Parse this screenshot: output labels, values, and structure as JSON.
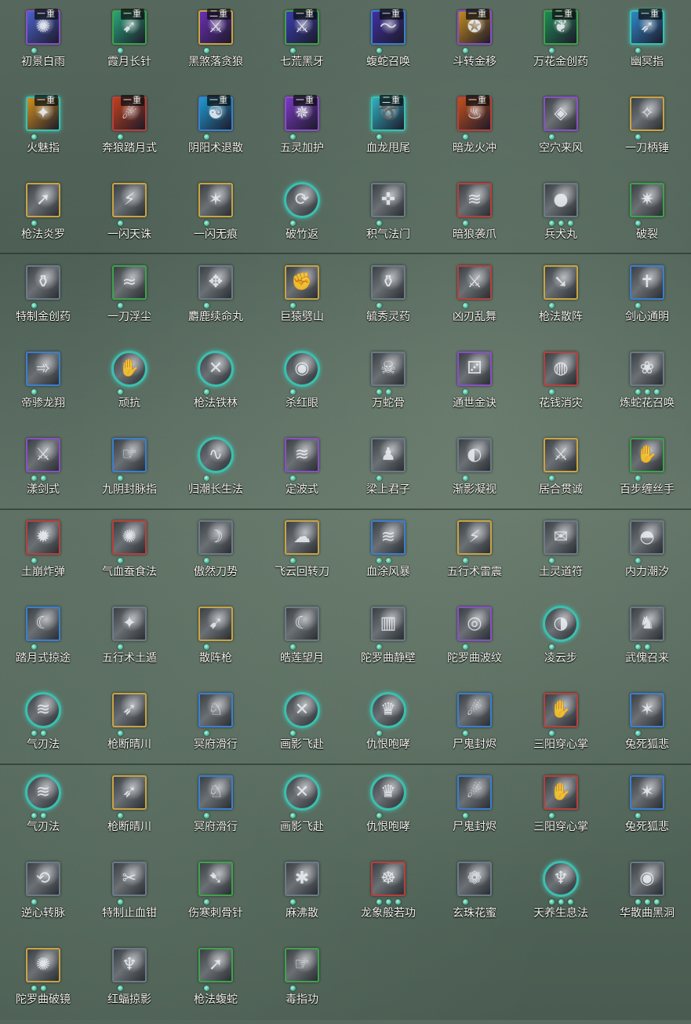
{
  "colors": {
    "border_purple": "#8a4fc7",
    "border_gold": "#c9a443",
    "border_red": "#b8403c",
    "border_blue": "#3a7fd0",
    "border_green": "#3fa24c",
    "border_teal": "#3cbfae",
    "border_gray": "#6c7b86",
    "dot_teal": "#3fb99a"
  },
  "skills": [
    {
      "name": "初景白雨",
      "rank": "一重",
      "border": "purple",
      "shape": "square",
      "dots": 1,
      "icon": "water-swirl-icon",
      "tint": "#4a62c9"
    },
    {
      "name": "霞月长针",
      "rank": "一重",
      "border": "green",
      "shape": "square",
      "dots": 1,
      "icon": "needle-icon",
      "tint": "#2aa57a"
    },
    {
      "name": "黑煞落贪狼",
      "rank": "二重",
      "border": "gold",
      "shape": "square",
      "dots": 1,
      "icon": "dark-blade-icon",
      "tint": "#6a2fb5"
    },
    {
      "name": "七荒黑牙",
      "rank": "一重",
      "border": "green",
      "shape": "square",
      "dots": 1,
      "icon": "fang-icon",
      "tint": "#3a3fb0"
    },
    {
      "name": "蝮蛇召唤",
      "rank": "一重",
      "border": "blue",
      "shape": "square",
      "dots": 1,
      "icon": "snake-icon",
      "tint": "#4030a0"
    },
    {
      "name": "斗转金移",
      "rank": "一重",
      "border": "purple",
      "shape": "square",
      "dots": 1,
      "icon": "gold-swirl-icon",
      "tint": "#c08a20"
    },
    {
      "name": "万花金创药",
      "rank": "二重",
      "border": "green",
      "shape": "square",
      "dots": 1,
      "icon": "herb-icon",
      "tint": "#1f8a55"
    },
    {
      "name": "幽冥指",
      "rank": "一重",
      "border": "teal",
      "shape": "square",
      "dots": 1,
      "icon": "finger-strike-icon",
      "tint": "#2f88c9"
    },
    {
      "name": "火魅指",
      "rank": "一重",
      "border": "teal",
      "shape": "square",
      "dots": 1,
      "icon": "fire-finger-icon",
      "tint": "#d0901f"
    },
    {
      "name": "奔狼踏月式",
      "rank": "一重",
      "border": "red",
      "shape": "square",
      "dots": 1,
      "icon": "wolf-icon",
      "tint": "#c0401c"
    },
    {
      "name": "阴阳术退散",
      "rank": "一重",
      "border": "blue",
      "shape": "square",
      "dots": 1,
      "icon": "yin-yang-icon",
      "tint": "#1f9ad0"
    },
    {
      "name": "五灵加护",
      "rank": "一重",
      "border": "purple",
      "shape": "square",
      "dots": 1,
      "icon": "five-spirit-icon",
      "tint": "#7a3ac0"
    },
    {
      "name": "血龙甩尾",
      "rank": "二重",
      "border": "teal",
      "shape": "square",
      "dots": 1,
      "icon": "dragon-tail-icon",
      "tint": "#2fb0c0"
    },
    {
      "name": "暗龙火冲",
      "rank": "一重",
      "border": "red",
      "shape": "square",
      "dots": 1,
      "icon": "flame-dash-icon",
      "tint": "#c0501c"
    },
    {
      "name": "空穴来风",
      "rank": "",
      "border": "purple",
      "shape": "square",
      "dots": 1,
      "icon": "coin-wind-icon",
      "tint": ""
    },
    {
      "name": "一刀柄锤",
      "rank": "",
      "border": "gold",
      "shape": "square",
      "dots": 1,
      "icon": "hilt-strike-icon",
      "tint": ""
    },
    {
      "name": "枪法炎罗",
      "rank": "",
      "border": "gold",
      "shape": "square",
      "dots": 1,
      "icon": "spear-icon",
      "tint": ""
    },
    {
      "name": "一闪天诛",
      "rank": "",
      "border": "gold",
      "shape": "square",
      "dots": 1,
      "icon": "flash-slash-icon",
      "tint": ""
    },
    {
      "name": "一闪无痕",
      "rank": "",
      "border": "gold",
      "shape": "square",
      "dots": 1,
      "icon": "shadow-slash-icon",
      "tint": ""
    },
    {
      "name": "破竹返",
      "rank": "",
      "border": "teal",
      "shape": "round",
      "dots": 1,
      "icon": "bamboo-counter-icon",
      "tint": ""
    },
    {
      "name": "积气法门",
      "rank": "",
      "border": "gray",
      "shape": "square",
      "dots": 1,
      "icon": "qi-gate-icon",
      "tint": ""
    },
    {
      "name": "暗狼袭爪",
      "rank": "",
      "border": "red",
      "shape": "square",
      "dots": 1,
      "icon": "claw-icon",
      "tint": ""
    },
    {
      "name": "兵犬丸",
      "rank": "",
      "border": "gray",
      "shape": "square",
      "dots": 3,
      "icon": "pill-icon",
      "tint": ""
    },
    {
      "name": "破裂",
      "rank": "",
      "border": "green",
      "shape": "square",
      "dots": 1,
      "icon": "shatter-icon",
      "tint": ""
    },
    {
      "name": "特制金创药",
      "rank": "",
      "border": "gray",
      "shape": "square",
      "dots": 1,
      "icon": "potion-icon",
      "tint": ""
    },
    {
      "name": "一刀浮尘",
      "rank": "",
      "border": "green",
      "shape": "square",
      "dots": 1,
      "icon": "dust-slash-icon",
      "tint": ""
    },
    {
      "name": "麝鹿续命丸",
      "rank": "",
      "border": "gray",
      "shape": "square",
      "dots": 1,
      "icon": "elixir-icon",
      "tint": ""
    },
    {
      "name": "巨猿劈山",
      "rank": "",
      "border": "gold",
      "shape": "square",
      "dots": 1,
      "icon": "ape-icon",
      "tint": ""
    },
    {
      "name": "毓秀灵药",
      "rank": "",
      "border": "gray",
      "shape": "square",
      "dots": 1,
      "icon": "gourd-icon",
      "tint": ""
    },
    {
      "name": "凶刃乱舞",
      "rank": "",
      "border": "red",
      "shape": "square",
      "dots": 1,
      "icon": "blade-dance-icon",
      "tint": ""
    },
    {
      "name": "枪法散阵",
      "rank": "",
      "border": "gold",
      "shape": "square",
      "dots": 1,
      "icon": "spear-sweep-icon",
      "tint": ""
    },
    {
      "name": "剑心通明",
      "rank": "",
      "border": "blue",
      "shape": "square",
      "dots": 1,
      "icon": "sword-heart-icon",
      "tint": ""
    },
    {
      "name": "帝骖龙翔",
      "rank": "",
      "border": "blue",
      "shape": "square",
      "dots": 1,
      "icon": "dragon-flight-icon",
      "tint": ""
    },
    {
      "name": "顽抗",
      "rank": "",
      "border": "teal",
      "shape": "round",
      "dots": 1,
      "icon": "resist-icon",
      "tint": ""
    },
    {
      "name": "枪法铁林",
      "rank": "",
      "border": "teal",
      "shape": "round",
      "dots": 1,
      "icon": "spear-forest-icon",
      "tint": ""
    },
    {
      "name": "杀红眼",
      "rank": "",
      "border": "teal",
      "shape": "round",
      "dots": 1,
      "icon": "rage-icon",
      "tint": ""
    },
    {
      "name": "万蛇骨",
      "rank": "",
      "border": "gray",
      "shape": "square",
      "dots": 2,
      "icon": "snake-bone-icon",
      "tint": ""
    },
    {
      "name": "通世金诀",
      "rank": "",
      "border": "purple",
      "shape": "square",
      "dots": 1,
      "icon": "dice-icon",
      "tint": ""
    },
    {
      "name": "花钱消灾",
      "rank": "",
      "border": "red",
      "shape": "square",
      "dots": 1,
      "icon": "money-bag-icon",
      "tint": ""
    },
    {
      "name": "炼蛇花召唤",
      "rank": "",
      "border": "gray",
      "shape": "square",
      "dots": 3,
      "icon": "serpent-flower-icon",
      "tint": ""
    },
    {
      "name": "漾剑式",
      "rank": "",
      "border": "purple",
      "shape": "square",
      "dots": 2,
      "icon": "ripple-sword-icon",
      "tint": ""
    },
    {
      "name": "九阴封脉指",
      "rank": "",
      "border": "blue",
      "shape": "square",
      "dots": 1,
      "icon": "seal-finger-icon",
      "tint": ""
    },
    {
      "name": "归潮长生法",
      "rank": "",
      "border": "teal",
      "shape": "round",
      "dots": 1,
      "icon": "tide-icon",
      "tint": ""
    },
    {
      "name": "定波式",
      "rank": "",
      "border": "purple",
      "shape": "square",
      "dots": 1,
      "icon": "wave-stance-icon",
      "tint": ""
    },
    {
      "name": "梁上君子",
      "rank": "",
      "border": "gray",
      "shape": "square",
      "dots": 1,
      "icon": "thief-icon",
      "tint": ""
    },
    {
      "name": "渐影凝视",
      "rank": "",
      "border": "gray",
      "shape": "square",
      "dots": 1,
      "icon": "gaze-icon",
      "tint": ""
    },
    {
      "name": "居合贯诚",
      "rank": "",
      "border": "gold",
      "shape": "square",
      "dots": 1,
      "icon": "iai-icon",
      "tint": ""
    },
    {
      "name": "百步缠丝手",
      "rank": "",
      "border": "green",
      "shape": "square",
      "dots": 1,
      "icon": "silk-hand-icon",
      "tint": ""
    },
    {
      "name": "土崩炸弹",
      "rank": "",
      "border": "red",
      "shape": "square",
      "dots": 1,
      "icon": "bomb-icon",
      "tint": ""
    },
    {
      "name": "气血蚕食法",
      "rank": "",
      "border": "red",
      "shape": "square",
      "dots": 1,
      "icon": "drain-icon",
      "tint": ""
    },
    {
      "name": "傲然刀势",
      "rank": "",
      "border": "gray",
      "shape": "square",
      "dots": 1,
      "icon": "proud-blade-icon",
      "tint": ""
    },
    {
      "name": "飞云回转刀",
      "rank": "",
      "border": "gold",
      "shape": "square",
      "dots": 1,
      "icon": "cloud-blade-icon",
      "tint": ""
    },
    {
      "name": "血涂风暴",
      "rank": "",
      "border": "blue",
      "shape": "square",
      "dots": 2,
      "icon": "blood-storm-icon",
      "tint": ""
    },
    {
      "name": "五行术雷震",
      "rank": "",
      "border": "gold",
      "shape": "square",
      "dots": 1,
      "icon": "thunder-icon",
      "tint": ""
    },
    {
      "name": "土灵道符",
      "rank": "",
      "border": "gray",
      "shape": "square",
      "dots": 1,
      "icon": "talisman-icon",
      "tint": ""
    },
    {
      "name": "内力潮汐",
      "rank": "",
      "border": "gray",
      "shape": "square",
      "dots": 1,
      "icon": "inner-tide-icon",
      "tint": ""
    },
    {
      "name": "踏月式掠途",
      "rank": "",
      "border": "blue",
      "shape": "square",
      "dots": 1,
      "icon": "moon-step-icon",
      "tint": ""
    },
    {
      "name": "五行术土遁",
      "rank": "",
      "border": "gray",
      "shape": "square",
      "dots": 1,
      "icon": "earth-escape-icon",
      "tint": ""
    },
    {
      "name": "散阵枪",
      "rank": "",
      "border": "gold",
      "shape": "square",
      "dots": 1,
      "icon": "scatter-spear-icon",
      "tint": ""
    },
    {
      "name": "皓莲望月",
      "rank": "",
      "border": "gray",
      "shape": "square",
      "dots": 1,
      "icon": "lotus-moon-icon",
      "tint": ""
    },
    {
      "name": "陀罗曲静壁",
      "rank": "",
      "border": "gray",
      "shape": "square",
      "dots": 1,
      "icon": "still-wall-icon",
      "tint": ""
    },
    {
      "name": "陀罗曲波纹",
      "rank": "",
      "border": "purple",
      "shape": "square",
      "dots": 1,
      "icon": "ripple-icon",
      "tint": ""
    },
    {
      "name": "凌云步",
      "rank": "",
      "border": "teal",
      "shape": "round",
      "dots": 1,
      "icon": "cloud-step-icon",
      "tint": ""
    },
    {
      "name": "武傀召来",
      "rank": "",
      "border": "gray",
      "shape": "square",
      "dots": 2,
      "icon": "puppet-icon",
      "tint": ""
    },
    {
      "name": "气刃法",
      "rank": "",
      "border": "teal",
      "shape": "round",
      "dots": 2,
      "icon": "qi-blade-icon",
      "tint": ""
    },
    {
      "name": "枪断晴川",
      "rank": "",
      "border": "gold",
      "shape": "square",
      "dots": 1,
      "icon": "spear-break-icon",
      "tint": ""
    },
    {
      "name": "冥府滑行",
      "rank": "",
      "border": "blue",
      "shape": "square",
      "dots": 1,
      "icon": "underworld-glide-icon",
      "tint": ""
    },
    {
      "name": "画影飞赴",
      "rank": "",
      "border": "teal",
      "shape": "round",
      "dots": 1,
      "icon": "shadow-rush-icon",
      "tint": ""
    },
    {
      "name": "仇恨咆哮",
      "rank": "",
      "border": "teal",
      "shape": "round",
      "dots": 1,
      "icon": "roar-icon",
      "tint": ""
    },
    {
      "name": "尸鬼封烬",
      "rank": "",
      "border": "blue",
      "shape": "square",
      "dots": 1,
      "icon": "ghoul-seal-icon",
      "tint": ""
    },
    {
      "name": "三阳穿心掌",
      "rank": "",
      "border": "red",
      "shape": "square",
      "dots": 1,
      "icon": "palm-icon",
      "tint": ""
    },
    {
      "name": "兔死狐悲",
      "rank": "",
      "border": "blue",
      "shape": "square",
      "dots": 1,
      "icon": "fox-icon",
      "tint": ""
    },
    {
      "name": "气刃法",
      "rank": "",
      "border": "teal",
      "shape": "round",
      "dots": 2,
      "icon": "qi-blade-icon",
      "tint": ""
    },
    {
      "name": "枪断晴川",
      "rank": "",
      "border": "gold",
      "shape": "square",
      "dots": 1,
      "icon": "spear-break-icon",
      "tint": ""
    },
    {
      "name": "冥府滑行",
      "rank": "",
      "border": "blue",
      "shape": "square",
      "dots": 1,
      "icon": "underworld-glide-icon",
      "tint": ""
    },
    {
      "name": "画影飞赴",
      "rank": "",
      "border": "teal",
      "shape": "round",
      "dots": 1,
      "icon": "shadow-rush-icon",
      "tint": ""
    },
    {
      "name": "仇恨咆哮",
      "rank": "",
      "border": "teal",
      "shape": "round",
      "dots": 1,
      "icon": "roar-icon",
      "tint": ""
    },
    {
      "name": "尸鬼封烬",
      "rank": "",
      "border": "blue",
      "shape": "square",
      "dots": 1,
      "icon": "ghoul-seal-icon",
      "tint": ""
    },
    {
      "name": "三阳穿心掌",
      "rank": "",
      "border": "red",
      "shape": "square",
      "dots": 1,
      "icon": "palm-icon",
      "tint": ""
    },
    {
      "name": "兔死狐悲",
      "rank": "",
      "border": "blue",
      "shape": "square",
      "dots": 1,
      "icon": "fox-icon",
      "tint": ""
    },
    {
      "name": "逆心转脉",
      "rank": "",
      "border": "gray",
      "shape": "square",
      "dots": 1,
      "icon": "reverse-pulse-icon",
      "tint": ""
    },
    {
      "name": "特制止血钳",
      "rank": "",
      "border": "gray",
      "shape": "square",
      "dots": 1,
      "icon": "clamp-icon",
      "tint": ""
    },
    {
      "name": "伤寒刺骨针",
      "rank": "",
      "border": "green",
      "shape": "square",
      "dots": 1,
      "icon": "bone-needle-icon",
      "tint": ""
    },
    {
      "name": "麻沸散",
      "rank": "",
      "border": "gray",
      "shape": "square",
      "dots": 1,
      "icon": "numbing-powder-icon",
      "tint": ""
    },
    {
      "name": "龙象般若功",
      "rank": "",
      "border": "red",
      "shape": "square",
      "dots": 3,
      "icon": "prajna-icon",
      "tint": ""
    },
    {
      "name": "玄珠花蜜",
      "rank": "",
      "border": "gray",
      "shape": "square",
      "dots": 1,
      "icon": "nectar-icon",
      "tint": ""
    },
    {
      "name": "天养生息法",
      "rank": "",
      "border": "teal",
      "shape": "round",
      "dots": 3,
      "icon": "rest-icon",
      "tint": ""
    },
    {
      "name": "华散曲黑洞",
      "rank": "",
      "border": "gray",
      "shape": "square",
      "dots": 3,
      "icon": "black-hole-icon",
      "tint": ""
    },
    {
      "name": "陀罗曲破镜",
      "rank": "",
      "border": "gold",
      "shape": "square",
      "dots": 2,
      "icon": "mirror-break-icon",
      "tint": ""
    },
    {
      "name": "红蝠掠影",
      "rank": "",
      "border": "gray",
      "shape": "square",
      "dots": 1,
      "icon": "bat-icon",
      "tint": ""
    },
    {
      "name": "枪法蝮蛇",
      "rank": "",
      "border": "green",
      "shape": "square",
      "dots": 1,
      "icon": "viper-spear-icon",
      "tint": ""
    },
    {
      "name": "毒指功",
      "rank": "",
      "border": "green",
      "shape": "square",
      "dots": 1,
      "icon": "poison-finger-icon",
      "tint": ""
    }
  ],
  "glyphs": {
    "water-swirl-icon": "✺",
    "needle-icon": "➹",
    "dark-blade-icon": "⚔",
    "fang-icon": "⚔",
    "snake-icon": "〜",
    "gold-swirl-icon": "✪",
    "herb-icon": "❦",
    "finger-strike-icon": "➶",
    "fire-finger-icon": "✦",
    "wolf-icon": "☄",
    "yin-yang-icon": "☯",
    "five-spirit-icon": "✵",
    "dragon-tail-icon": "➰",
    "flame-dash-icon": "♨",
    "coin-wind-icon": "◈",
    "hilt-strike-icon": "✧",
    "spear-icon": "➚",
    "flash-slash-icon": "⚡",
    "shadow-slash-icon": "✶",
    "bamboo-counter-icon": "⟳",
    "qi-gate-icon": "✜",
    "claw-icon": "≋",
    "pill-icon": "●",
    "shatter-icon": "✷",
    "potion-icon": "⚱",
    "dust-slash-icon": "≈",
    "elixir-icon": "✥",
    "ape-icon": "✊",
    "gourd-icon": "⚱",
    "blade-dance-icon": "⚔",
    "spear-sweep-icon": "➘",
    "sword-heart-icon": "✝",
    "dragon-flight-icon": "➾",
    "resist-icon": "✋",
    "spear-forest-icon": "✕",
    "rage-icon": "◉",
    "snake-bone-icon": "☠",
    "dice-icon": "⚂",
    "money-bag-icon": "◍",
    "serpent-flower-icon": "❀",
    "ripple-sword-icon": "⚔",
    "seal-finger-icon": "☞",
    "tide-icon": "∿",
    "wave-stance-icon": "≋",
    "thief-icon": "♟",
    "gaze-icon": "◐",
    "iai-icon": "⚔",
    "silk-hand-icon": "✋",
    "bomb-icon": "✹",
    "drain-icon": "✺",
    "proud-blade-icon": "☽",
    "cloud-blade-icon": "☁",
    "blood-storm-icon": "≋",
    "thunder-icon": "⚡",
    "talisman-icon": "✉",
    "inner-tide-icon": "◓",
    "moon-step-icon": "☾",
    "earth-escape-icon": "✦",
    "scatter-spear-icon": "➹",
    "lotus-moon-icon": "☾",
    "still-wall-icon": "▥",
    "ripple-icon": "◎",
    "cloud-step-icon": "◑",
    "puppet-icon": "♞",
    "qi-blade-icon": "≋",
    "spear-break-icon": "➶",
    "underworld-glide-icon": "♘",
    "shadow-rush-icon": "✕",
    "roar-icon": "♛",
    "ghoul-seal-icon": "☄",
    "palm-icon": "✋",
    "fox-icon": "✶",
    "reverse-pulse-icon": "⟲",
    "clamp-icon": "✂",
    "bone-needle-icon": "➷",
    "numbing-powder-icon": "✱",
    "prajna-icon": "☸",
    "nectar-icon": "❁",
    "rest-icon": "♆",
    "black-hole-icon": "◉",
    "mirror-break-icon": "✺",
    "bat-icon": "♆",
    "viper-spear-icon": "➚",
    "poison-finger-icon": "☞"
  }
}
